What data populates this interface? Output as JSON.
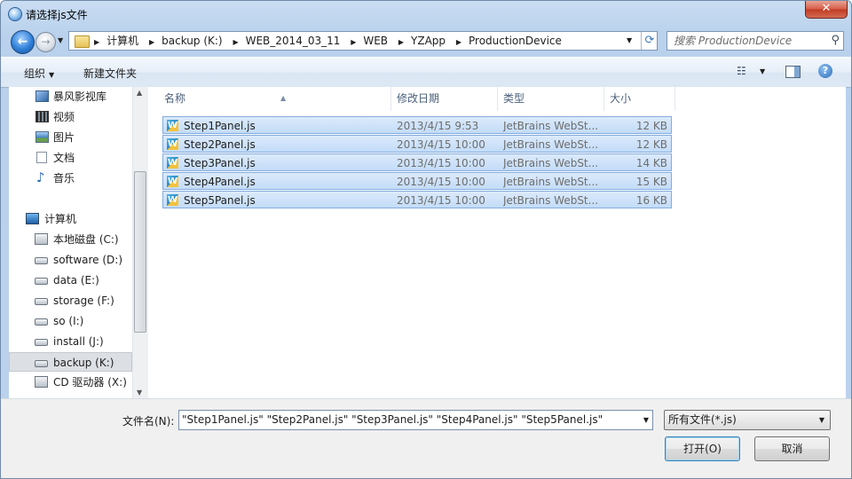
{
  "window": {
    "title": "请选择js文件",
    "close_glyph": "✕"
  },
  "nav": {
    "back_glyph": "←",
    "forward_glyph": "→",
    "breadcrumbs": [
      "计算机",
      "backup (K:)",
      "WEB_2014_03_11",
      "WEB",
      "YZApp",
      "ProductionDevice"
    ],
    "search_placeholder": "搜索 ProductionDevice"
  },
  "toolbar": {
    "organize": "组织",
    "new_folder": "新建文件夹",
    "help_glyph": "?"
  },
  "sidebar": {
    "items": [
      {
        "label": "暴风影视库",
        "icon": "library-icon"
      },
      {
        "label": "视频",
        "icon": "video-library-icon"
      },
      {
        "label": "图片",
        "icon": "pictures-library-icon"
      },
      {
        "label": "文档",
        "icon": "documents-library-icon"
      },
      {
        "label": "音乐",
        "icon": "music-library-icon"
      },
      {
        "label": "计算机",
        "icon": "computer-icon"
      },
      {
        "label": "本地磁盘 (C:)",
        "icon": "system-drive-icon"
      },
      {
        "label": "software (D:)",
        "icon": "hard-drive-icon"
      },
      {
        "label": "data (E:)",
        "icon": "hard-drive-icon"
      },
      {
        "label": "storage (F:)",
        "icon": "hard-drive-icon"
      },
      {
        "label": "so (I:)",
        "icon": "hard-drive-icon"
      },
      {
        "label": "install (J:)",
        "icon": "hard-drive-icon"
      },
      {
        "label": "backup (K:)",
        "icon": "hard-drive-icon",
        "selected": true
      },
      {
        "label": "CD 驱动器 (X:)",
        "icon": "cd-drive-icon"
      }
    ]
  },
  "files": {
    "columns": [
      "名称",
      "修改日期",
      "类型",
      "大小"
    ],
    "rows": [
      {
        "name": "Step1Panel.js",
        "date": "2013/4/15 9:53",
        "type": "JetBrains WebSt...",
        "size": "12 KB"
      },
      {
        "name": "Step2Panel.js",
        "date": "2013/4/15 10:00",
        "type": "JetBrains WebSt...",
        "size": "12 KB"
      },
      {
        "name": "Step3Panel.js",
        "date": "2013/4/15 10:00",
        "type": "JetBrains WebSt...",
        "size": "14 KB"
      },
      {
        "name": "Step4Panel.js",
        "date": "2013/4/15 10:00",
        "type": "JetBrains WebSt...",
        "size": "15 KB"
      },
      {
        "name": "Step5Panel.js",
        "date": "2013/4/15 10:00",
        "type": "JetBrains WebSt...",
        "size": "16 KB"
      }
    ]
  },
  "footer": {
    "filename_label": "文件名(N):",
    "filename_value": "\"Step1Panel.js\" \"Step2Panel.js\" \"Step3Panel.js\" \"Step4Panel.js\" \"Step5Panel.js\"",
    "filetype": "所有文件(*.js)",
    "open": "打开(O)",
    "cancel": "取消"
  }
}
